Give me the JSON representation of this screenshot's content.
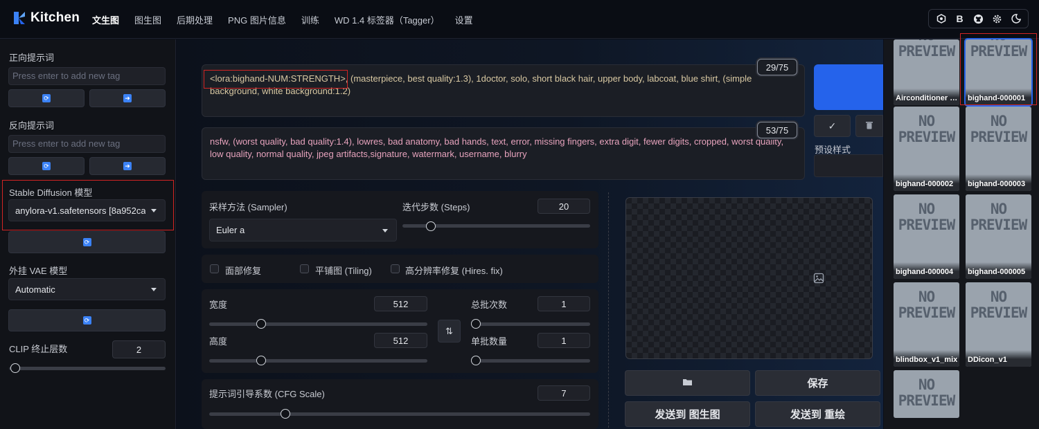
{
  "app": {
    "name": "Kitchen"
  },
  "nav": {
    "items": [
      "文生图",
      "图生图",
      "后期处理",
      "PNG 图片信息",
      "训练",
      "WD 1.4 标签器（Tagger）",
      "设置"
    ],
    "active_index": 0
  },
  "topbar_icons": [
    "hexagon-settings-icon",
    "b-icon",
    "github-icon",
    "gear-icon",
    "moon-icon"
  ],
  "topbar_b_label": "B",
  "sidebar": {
    "positive_label": "正向提示词",
    "positive_placeholder": "Press enter to add new tag",
    "negative_label": "反向提示词",
    "negative_placeholder": "Press enter to add new tag",
    "model_label": "Stable Diffusion 模型",
    "model_value": "anylora-v1.safetensors [8a952ca",
    "vae_label": "外挂 VAE 模型",
    "vae_value": "Automatic",
    "clip_label": "CLIP 终止层数",
    "clip_value": "2",
    "clip_level": 0.04
  },
  "prompt": {
    "lora_tag": "<lora:bighand-NUM:STRENGTH>",
    "rest": ", (masterpiece, best quality:1.3), 1doctor, solo, short black hair, upper body, labcoat, blue shirt, (simple background, white background:1.2)",
    "token_count": "29/75"
  },
  "negative_prompt": {
    "text": "nsfw, (worst quality, bad quality:1.4), lowres, bad anatomy, bad hands, text, error, missing fingers, extra digit, fewer digits, cropped, worst quality, low quality, normal quality, jpeg artifacts,signature, watermark, username, blurry",
    "token_count": "53/75"
  },
  "styles": {
    "label": "预设样式"
  },
  "params": {
    "sampler_label": "采样方法 (Sampler)",
    "sampler_value": "Euler a",
    "steps_label": "迭代步数 (Steps)",
    "steps_value": "20",
    "steps_level": 0.15,
    "face_restore_label": "面部修复",
    "tiling_label": "平铺图 (Tiling)",
    "hires_label": "高分辨率修复 (Hires. fix)",
    "width_label": "宽度",
    "width_value": "512",
    "height_label": "高度",
    "height_value": "512",
    "batch_count_label": "总批次数",
    "batch_count_value": "1",
    "batch_size_label": "单批数量",
    "batch_size_value": "1",
    "cfg_label": "提示词引导系数 (CFG Scale)",
    "cfg_value": "7",
    "cfg_level": 0.2
  },
  "output": {
    "save_label": "保存",
    "send_img2img_label": "发送到 图生图",
    "send_inpaint_label": "发送到 重绘"
  },
  "gallery": {
    "placeholder_text": "NO PREVIEW",
    "cards": [
      {
        "name": "Airconditioner S...",
        "selected": false
      },
      {
        "name": "bighand-000001",
        "selected": true
      },
      {
        "name": "bighand-000002",
        "selected": false
      },
      {
        "name": "bighand-000003",
        "selected": false
      },
      {
        "name": "bighand-000004",
        "selected": false
      },
      {
        "name": "bighand-000005",
        "selected": false
      },
      {
        "name": "blindbox_v1_mix",
        "selected": false
      },
      {
        "name": "DDicon_v1",
        "selected": false
      },
      {
        "name": "",
        "selected": false
      }
    ]
  },
  "colors": {
    "accent": "#2563eb",
    "highlight": "#d32424"
  }
}
